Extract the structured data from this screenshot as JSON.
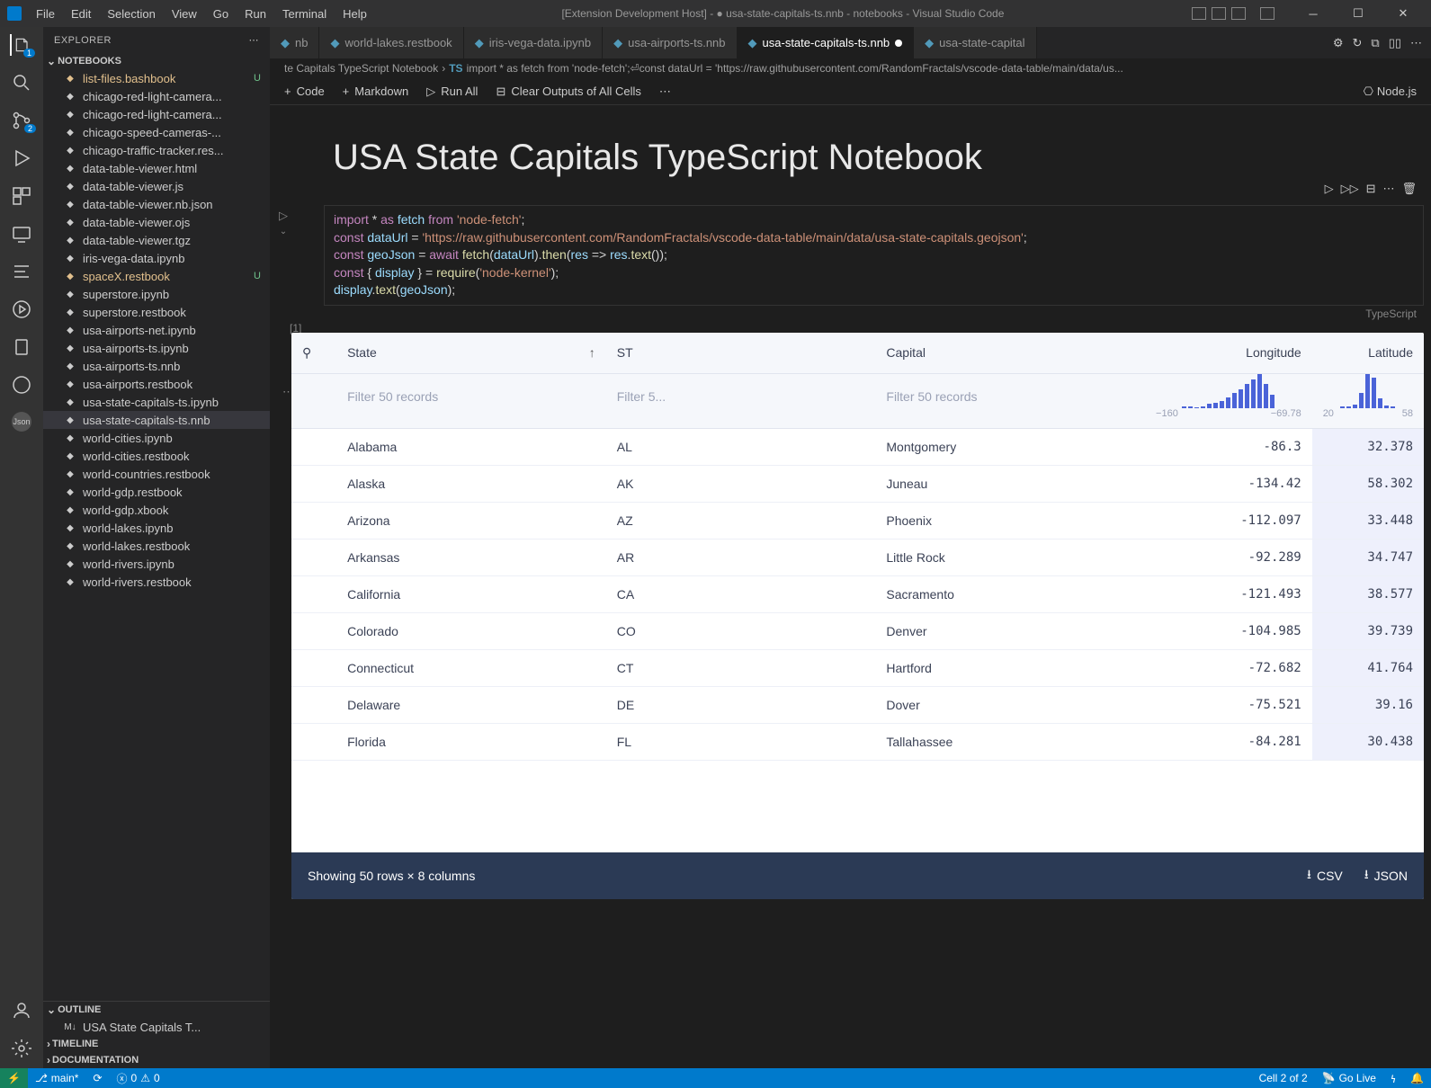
{
  "window": {
    "title": "[Extension Development Host] - ● usa-state-capitals-ts.nnb - notebooks - Visual Studio Code"
  },
  "menu": [
    "File",
    "Edit",
    "Selection",
    "View",
    "Go",
    "Run",
    "Terminal",
    "Help"
  ],
  "explorer": {
    "title": "EXPLORER",
    "section_notebooks": "NOTEBOOKS",
    "section_outline": "OUTLINE",
    "section_timeline": "TIMELINE",
    "section_documentation": "DOCUMENTATION",
    "outline_item": "USA State Capitals T...",
    "files": [
      {
        "name": "list-files.bashbook",
        "status": "U",
        "modified": true
      },
      {
        "name": "chicago-red-light-camera..."
      },
      {
        "name": "chicago-red-light-camera..."
      },
      {
        "name": "chicago-speed-cameras-..."
      },
      {
        "name": "chicago-traffic-tracker.res..."
      },
      {
        "name": "data-table-viewer.html"
      },
      {
        "name": "data-table-viewer.js"
      },
      {
        "name": "data-table-viewer.nb.json"
      },
      {
        "name": "data-table-viewer.ojs"
      },
      {
        "name": "data-table-viewer.tgz"
      },
      {
        "name": "iris-vega-data.ipynb"
      },
      {
        "name": "spaceX.restbook",
        "status": "U",
        "modified": true
      },
      {
        "name": "superstore.ipynb"
      },
      {
        "name": "superstore.restbook"
      },
      {
        "name": "usa-airports-net.ipynb"
      },
      {
        "name": "usa-airports-ts.ipynb"
      },
      {
        "name": "usa-airports-ts.nnb"
      },
      {
        "name": "usa-airports.restbook"
      },
      {
        "name": "usa-state-capitals-ts.ipynb"
      },
      {
        "name": "usa-state-capitals-ts.nnb",
        "selected": true
      },
      {
        "name": "world-cities.ipynb"
      },
      {
        "name": "world-cities.restbook"
      },
      {
        "name": "world-countries.restbook"
      },
      {
        "name": "world-gdp.restbook"
      },
      {
        "name": "world-gdp.xbook"
      },
      {
        "name": "world-lakes.ipynb"
      },
      {
        "name": "world-lakes.restbook"
      },
      {
        "name": "world-rivers.ipynb"
      },
      {
        "name": "world-rivers.restbook"
      }
    ]
  },
  "tabs": [
    {
      "label": "nb"
    },
    {
      "label": "world-lakes.restbook"
    },
    {
      "label": "iris-vega-data.ipynb"
    },
    {
      "label": "usa-airports-ts.nnb"
    },
    {
      "label": "usa-state-capitals-ts.nnb",
      "active": true,
      "dirty": true
    },
    {
      "label": "usa-state-capital"
    }
  ],
  "breadcrumb": {
    "part1": "te Capitals TypeScript Notebook",
    "part2": "import * as fetch from 'node-fetch';⏎const dataUrl = 'https://raw.githubusercontent.com/RandomFractals/vscode-data-table/main/data/us..."
  },
  "nbtoolbar": {
    "code": "Code",
    "markdown": "Markdown",
    "runall": "Run All",
    "clear": "Clear Outputs of All Cells",
    "kernel": "Node.js"
  },
  "notebook": {
    "title": "USA State Capitals TypeScript Notebook",
    "cell_index": "[1]",
    "lang": "TypeScript",
    "code_url": "'https://raw.githubusercontent.com/RandomFractals/vscode-data-table/main/data/usa-state-capitals.geojson'"
  },
  "table": {
    "headers": {
      "state": "State",
      "st": "ST",
      "capital": "Capital",
      "lon": "Longitude",
      "lat": "Latitude"
    },
    "filter_placeholder": "Filter 50 records",
    "filter_placeholder_short": "Filter 5...",
    "lon_range": {
      "min": "−160",
      "max": "−69.78"
    },
    "lat_range": {
      "min": "20",
      "max": "58"
    },
    "rows": [
      {
        "state": "Alabama",
        "st": "AL",
        "capital": "Montgomery",
        "lon": "-86.3",
        "lat": "32.378"
      },
      {
        "state": "Alaska",
        "st": "AK",
        "capital": "Juneau",
        "lon": "-134.42",
        "lat": "58.302"
      },
      {
        "state": "Arizona",
        "st": "AZ",
        "capital": "Phoenix",
        "lon": "-112.097",
        "lat": "33.448"
      },
      {
        "state": "Arkansas",
        "st": "AR",
        "capital": "Little Rock",
        "lon": "-92.289",
        "lat": "34.747"
      },
      {
        "state": "California",
        "st": "CA",
        "capital": "Sacramento",
        "lon": "-121.493",
        "lat": "38.577"
      },
      {
        "state": "Colorado",
        "st": "CO",
        "capital": "Denver",
        "lon": "-104.985",
        "lat": "39.739"
      },
      {
        "state": "Connecticut",
        "st": "CT",
        "capital": "Hartford",
        "lon": "-72.682",
        "lat": "41.764"
      },
      {
        "state": "Delaware",
        "st": "DE",
        "capital": "Dover",
        "lon": "-75.521",
        "lat": "39.16"
      },
      {
        "state": "Florida",
        "st": "FL",
        "capital": "Tallahassee",
        "lon": "-84.281",
        "lat": "30.438"
      }
    ],
    "footer": "Showing 50 rows × 8 columns",
    "csv": "CSV",
    "json": "JSON"
  },
  "statusbar": {
    "branch": "main*",
    "sync": "",
    "errors": "0",
    "warnings": "0",
    "cell": "Cell 2 of 2",
    "golive": "Go Live"
  },
  "activity_badges": {
    "explorer": "1",
    "scm": "2"
  }
}
